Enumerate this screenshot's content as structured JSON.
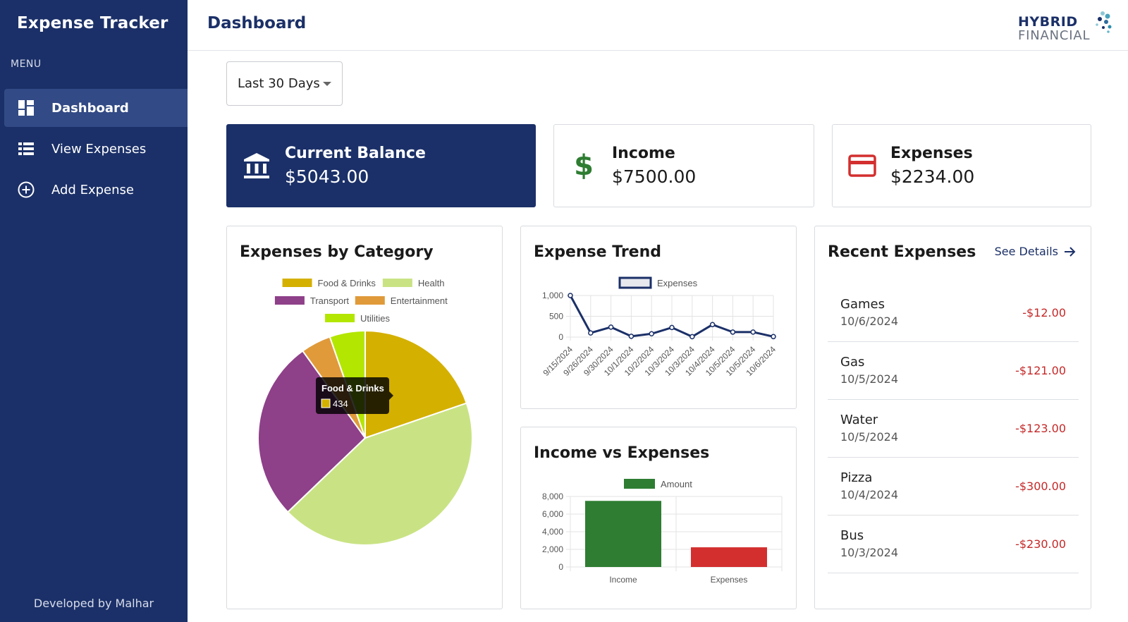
{
  "sidebar": {
    "app_title": "Expense Tracker",
    "menu_label": "MENU",
    "items": [
      {
        "label": "Dashboard",
        "icon": "dashboard-icon",
        "active": true
      },
      {
        "label": "View Expenses",
        "icon": "list-icon",
        "active": false
      },
      {
        "label": "Add Expense",
        "icon": "add-circle-icon",
        "active": false
      }
    ],
    "footer": "Developed by Malhar"
  },
  "header": {
    "title": "Dashboard",
    "logo_top": "HYBRID",
    "logo_bottom": "FINANCIAL"
  },
  "filter": {
    "selected": "Last 30 Days"
  },
  "summary": {
    "balance": {
      "title": "Current Balance",
      "value": "$5043.00",
      "icon": "bank-icon"
    },
    "income": {
      "title": "Income",
      "value": "$7500.00",
      "icon": "dollar-icon"
    },
    "expenses": {
      "title": "Expenses",
      "value": "$2234.00",
      "icon": "credit-card-icon"
    }
  },
  "colors": {
    "primary": "#1b3068",
    "income_green": "#2e7d32",
    "expense_red": "#d32f2f"
  },
  "panels": {
    "category_title": "Expenses by Category",
    "trend_title": "Expense Trend",
    "income_vs_title": "Income vs Expenses",
    "recent_title": "Recent Expenses",
    "see_details": "See Details"
  },
  "tooltip": {
    "label": "Food & Drinks",
    "value": "434"
  },
  "chart_data": [
    {
      "type": "pie",
      "title": "Expenses by Category",
      "categories": [
        "Food & Drinks",
        "Health",
        "Transport",
        "Entertainment",
        "Utilities"
      ],
      "values": [
        434,
        948,
        599,
        100,
        118
      ],
      "colors": [
        "#d4b000",
        "#c9e384",
        "#8e4089",
        "#e09a3a",
        "#b3e600"
      ],
      "legend": "top"
    },
    {
      "type": "line",
      "title": "Expense Trend",
      "series": [
        {
          "name": "Expenses",
          "values": [
            1000,
            100,
            240,
            20,
            80,
            230,
            10,
            300,
            120,
            121,
            12
          ]
        }
      ],
      "x": [
        "9/15/2024",
        "9/26/2024",
        "9/30/2024",
        "10/1/2024",
        "10/2/2024",
        "10/3/2024",
        "10/3/2024",
        "10/4/2024",
        "10/5/2024",
        "10/5/2024",
        "10/6/2024"
      ],
      "yticks": [
        "0",
        "500",
        "1,000"
      ],
      "ylim": [
        0,
        1000
      ],
      "color": "#1b3068",
      "grid": true,
      "legend": "top"
    },
    {
      "type": "bar",
      "title": "Income vs Expenses",
      "categories": [
        "Income",
        "Expenses"
      ],
      "series": [
        {
          "name": "Amount",
          "values": [
            7500,
            2234
          ]
        }
      ],
      "colors": [
        "#2e7d32",
        "#d32f2f"
      ],
      "yticks": [
        "0",
        "2,000",
        "4,000",
        "6,000",
        "8,000"
      ],
      "ylim": [
        0,
        8000
      ],
      "grid": true,
      "legend": "top"
    }
  ],
  "recent": [
    {
      "name": "Games",
      "date": "10/6/2024",
      "amount": "-$12.00"
    },
    {
      "name": "Gas",
      "date": "10/5/2024",
      "amount": "-$121.00"
    },
    {
      "name": "Water",
      "date": "10/5/2024",
      "amount": "-$123.00"
    },
    {
      "name": "Pizza",
      "date": "10/4/2024",
      "amount": "-$300.00"
    },
    {
      "name": "Bus",
      "date": "10/3/2024",
      "amount": "-$230.00"
    }
  ]
}
